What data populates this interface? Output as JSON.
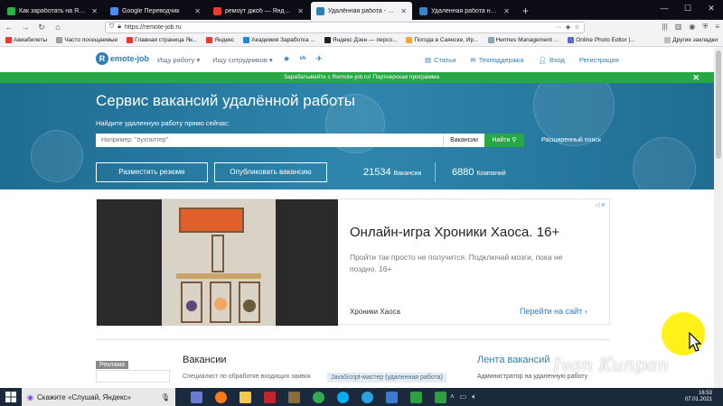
{
  "browser": {
    "tabs": [
      {
        "title": "Как заработать на Яндекс Дзен",
        "fav_color": "#2db14b",
        "active": false
      },
      {
        "title": "Google Переводчик",
        "fav_color": "#4a8af4",
        "active": false
      },
      {
        "title": "ремоут джоб — Яндекс: нашл",
        "fav_color": "#e63b2e",
        "active": false
      },
      {
        "title": "Удалённая работа - вакансии",
        "fav_color": "#2e7fb3",
        "active": true
      },
      {
        "title": "Удаленная работа на дому и",
        "fav_color": "#3a86c8",
        "active": false
      }
    ],
    "new_tab": "+",
    "url": "https://remote-job.ru",
    "bookmarks": [
      {
        "label": "Авиабилеты",
        "color": "#e53935"
      },
      {
        "label": "Часто посещаемые",
        "color": "#9e9e9e"
      },
      {
        "label": "Главная страница Як...",
        "color": "#e53935"
      },
      {
        "label": "Яндекс",
        "color": "#e53935"
      },
      {
        "label": "Академия Заработка ...",
        "color": "#1e88e5"
      },
      {
        "label": "Яндекс Дзен — персо...",
        "color": "#212121"
      },
      {
        "label": "Погода в Саянске, Ир...",
        "color": "#f9a825"
      },
      {
        "label": "Hermes Management ...",
        "color": "#90a4ae"
      },
      {
        "label": "Online Photo Editor |...",
        "color": "#5c6bc0"
      }
    ],
    "bookmarks_other": "Другие закладки"
  },
  "site": {
    "logo_text": "emote-job",
    "logo_letter": "R",
    "nav": [
      "Ищу работу ▾",
      "Ищу сотрудников ▾"
    ],
    "header_links": [
      {
        "label": "Статьи",
        "icon": "news-icon"
      },
      {
        "label": "Техподдержка",
        "icon": "mail-icon"
      },
      {
        "label": "Вход",
        "icon": "user-icon"
      },
      {
        "label": "Регистрация",
        "icon": ""
      }
    ],
    "promo": "Зарабатывайте с Remote-job.ru! Партнерская программа",
    "hero": {
      "title": "Сервис вакансий удалённой работы",
      "subtitle": "Найдите удаленную работу прямо сейчас:",
      "search_placeholder": "Например: \"бухгалтер\"",
      "search_scope": "Вакансии",
      "search_button": "Найти",
      "advanced": "Расширенный поиск",
      "post_resume": "Разместить резюме",
      "post_vacancy": "Опубликовать вакансию",
      "vacancies_count": "21534",
      "vacancies_label": "Вакансии",
      "companies_count": "6880",
      "companies_label": "Компаний"
    },
    "ad": {
      "title": "Онлайн-игра Хроники Хаоса. 16+",
      "desc": "Пройти так просто не получится. Подключай мозги, пока не поздно. 16+",
      "brand": "Хроники Хаоса",
      "link": "Перейти на сайт"
    },
    "lower": {
      "reklama": "Реклама",
      "vacancies_title": "Вакансии",
      "vacancy_item": "Специалист по обработке входящих заявок",
      "vacancy_tag": "JavaScript-мастер (удаленная работа)",
      "feed_title": "Лента вакансий",
      "feed_item": "Администратор на удаленную работу"
    }
  },
  "watermark": "Ivan Kunpan",
  "taskbar": {
    "search_text": "Скажите «Слушай, Яндекс»",
    "time": "16:53",
    "date": "07.01.2021",
    "apps": [
      {
        "name": "calculator-app",
        "color": "#6a7bd1"
      },
      {
        "name": "firefox-app",
        "color": "#ff7a1a"
      },
      {
        "name": "explorer-app",
        "color": "#f2c94c"
      },
      {
        "name": "mail-app",
        "color": "#c1272d"
      },
      {
        "name": "paint-app",
        "color": "#8a6d3b"
      },
      {
        "name": "chrome-app",
        "color": "#34a853"
      },
      {
        "name": "skype-app",
        "color": "#00aff0"
      },
      {
        "name": "telegram-app",
        "color": "#2aa3e0"
      },
      {
        "name": "uploader-app",
        "color": "#3c7bd4"
      },
      {
        "name": "camtasia-app",
        "color": "#2ea043"
      },
      {
        "name": "camtasia-rec-app",
        "color": "#2ea043"
      }
    ]
  }
}
